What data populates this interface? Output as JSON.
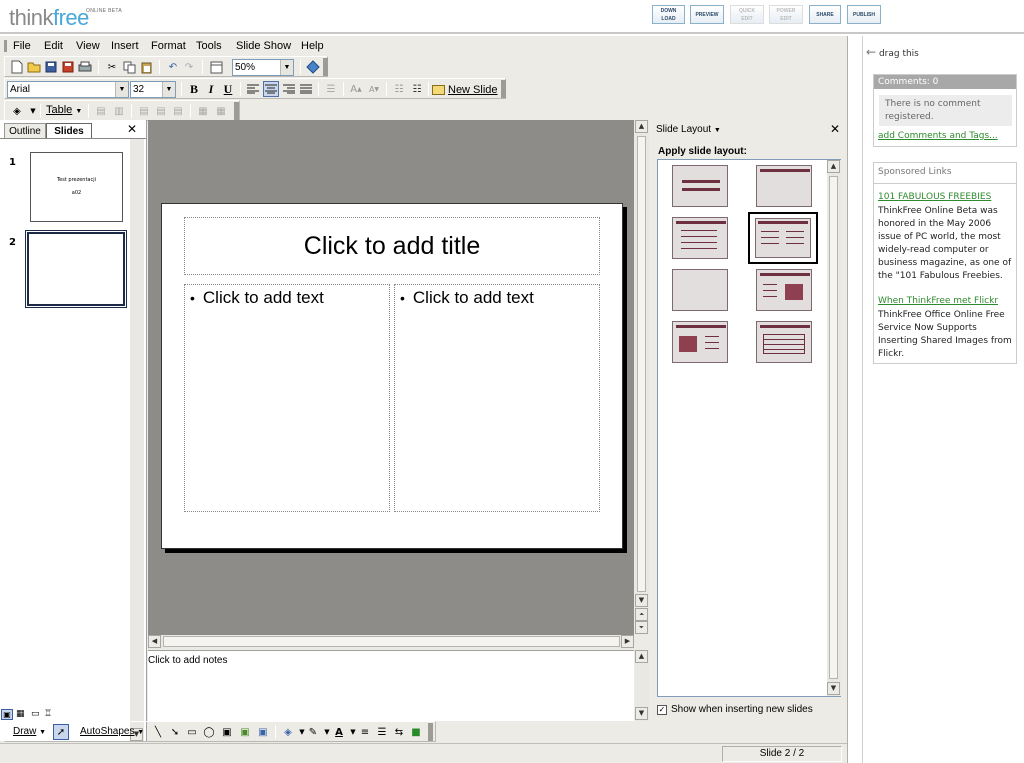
{
  "header": {
    "logo_think": "think",
    "logo_free": "free",
    "logo_tag": "ONLINE BETA",
    "buttons": [
      {
        "line1": "DOWN",
        "line2": "LOAD"
      },
      {
        "line1": "PREVIEW",
        "line2": ""
      },
      {
        "line1": "QUICK",
        "line2": "EDIT"
      },
      {
        "line1": "POWER",
        "line2": "EDIT"
      },
      {
        "line1": "SHARE",
        "line2": ""
      },
      {
        "line1": "PUBLISH",
        "line2": ""
      }
    ]
  },
  "menubar": [
    "File",
    "Edit",
    "View",
    "Insert",
    "Format",
    "Tools",
    "Slide Show",
    "Help"
  ],
  "toolbar": {
    "zoom": "50%",
    "font": "Arial",
    "font_size": "32",
    "bold": "B",
    "italic": "I",
    "underline": "U",
    "new_slide": "New Slide",
    "table": "Table"
  },
  "left_panel": {
    "tabs": [
      "Outline",
      "Slides"
    ],
    "close": "✕",
    "slides": [
      {
        "number": "1",
        "title": "Test prezentacji",
        "sub": "a02"
      },
      {
        "number": "2",
        "title": "",
        "sub": ""
      }
    ]
  },
  "slide": {
    "title_placeholder": "Click to add title",
    "left_text": "Click to add text",
    "right_text": "Click to add text",
    "bullet": "•"
  },
  "notes": {
    "placeholder": "Click to add notes"
  },
  "layout_panel": {
    "title": "Slide Layout",
    "close": "✕",
    "apply_label": "Apply slide layout:",
    "show_checkbox": "Show when inserting new slides",
    "show_checked": true
  },
  "drawbar": {
    "draw": "Draw",
    "autoshapes": "AutoShapes"
  },
  "statusbar": {
    "slide": "Slide 2 / 2"
  },
  "sidebar": {
    "drag": "drag this",
    "comments_header": "Comments: 0",
    "no_comment": "There is no comment registered.",
    "add_link": "add Comments and Tags...",
    "sponsored_title": "Sponsored Links",
    "ads": [
      {
        "title": "101 FABULOUS FREEBIES",
        "text": "ThinkFree Online Beta was honored in the May 2006 issue of PC world, the most widely-read computer or business magazine, as one of the \"101 Fabulous Freebies."
      },
      {
        "title": "When ThinkFree met Flickr",
        "text": "ThinkFree Office Online Free Service Now Supports Inserting Shared Images from Flickr."
      }
    ]
  },
  "colors": {
    "accent": "#4aa7d9",
    "layout_bar": "#6e3040",
    "link": "#2e8a2e"
  }
}
